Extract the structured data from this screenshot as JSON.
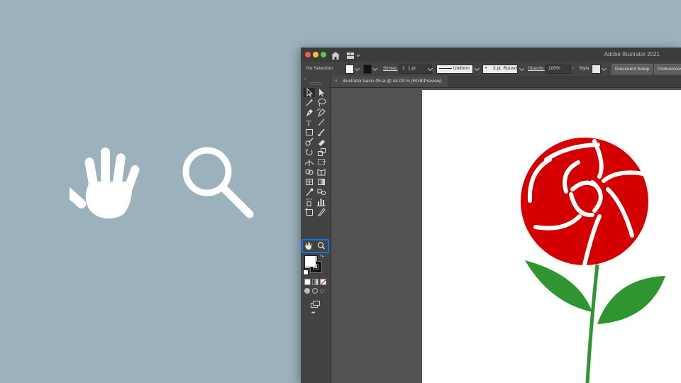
{
  "app": {
    "title": "Adobe Illustrator 2021",
    "document_tab": "illustrator-basic-05.ai @ 44.09 % (RGB/Preview)"
  },
  "control_bar": {
    "selection_label": "No Selection",
    "stroke_label": "Stroke:",
    "stroke_value": "1 pt",
    "profile_value": "Uniform",
    "brush_value": "3 pt. Round",
    "opacity_label": "Opacity:",
    "opacity_value": "100%",
    "style_label": "Style",
    "document_setup_button": "Document Setup",
    "preferences_button": "Preferences"
  },
  "toolbar": {
    "active_tools": [
      "Hand Tool",
      "Zoom Tool"
    ],
    "more_tools": "•••"
  },
  "colors": {
    "background": "#9bb1bc",
    "highlight": "#1473e6",
    "rose_red": "#d40000",
    "leaf_green": "#2e9530"
  }
}
